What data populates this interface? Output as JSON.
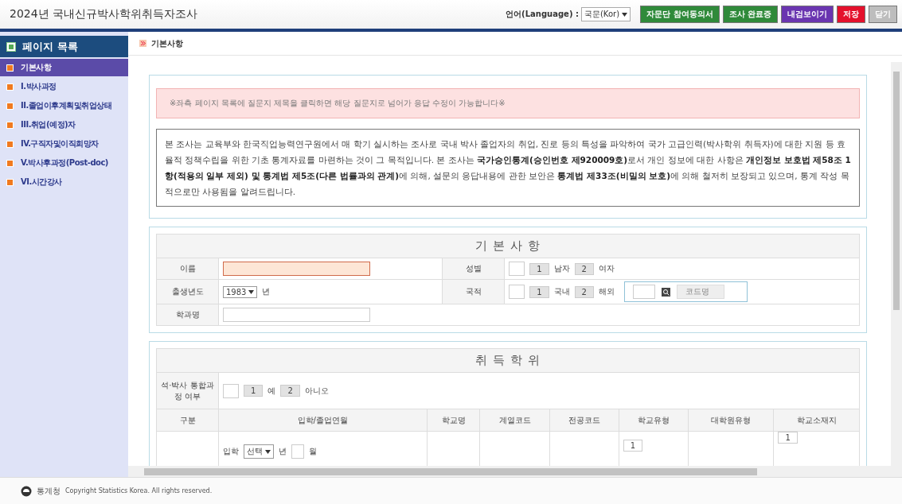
{
  "header": {
    "title": "2024년 국내신규박사학위취득자조사",
    "language_label": "언어(Language) :",
    "language_value": "국문(Kor)",
    "buttons": [
      {
        "label": "자문단 참여동의서",
        "color": "#2f8a3a"
      },
      {
        "label": "조사 완료증",
        "color": "#2f8a3a"
      },
      {
        "label": "내검보이기",
        "color": "#6a35b0"
      },
      {
        "label": "저장",
        "color": "#e4112c"
      },
      {
        "label": "닫기",
        "color": "#bdbdbd"
      }
    ]
  },
  "sidebar": {
    "title": "페이지 목록",
    "items": [
      {
        "label": "기본사항",
        "selected": true
      },
      {
        "label": "I.박사과정",
        "selected": false
      },
      {
        "label": "II.졸업이후계획및취업상태",
        "selected": false
      },
      {
        "label": "III.취업(예정)자",
        "selected": false
      },
      {
        "label": "IV.구직자및이직희망자",
        "selected": false
      },
      {
        "label": "V.박사후과정(Post-doc)",
        "selected": false
      },
      {
        "label": "VI.시간강사",
        "selected": false
      }
    ]
  },
  "breadcrumb": "기본사항",
  "notice": "※좌측 페이지 목록에 질문지 제목을 클릭하면 해당 질문지로 넘어가 응답 수정이 가능합니다※",
  "intro": "본 조사는 교육부와 한국직업능력연구원에서 매 학기 실시하는 조사로 국내 박사 졸업자의 취업, 진로 등의 특성을 파악하여 국가 고급인력(박사학위 취득자)에 대한 지원 등 효율적 정책수립을 위한 기초 통계자료를 마련하는 것이 그 목적입니다. 본 조사는 **국가승인통계(승인번호 제920009호)**로서 개인 정보에 대한 사항은 **개인정보 보호법 제58조 1항(적용의 일부 제외) 및 통계법 제5조(다른 법률과의 관계)**에 의해, 설문의 응답내용에 관한 보안은 **통계법 제33조(비밀의 보호)**에 의해 철저히 보장되고 있으며, 통계 작성 목적으로만 사용됨을 알려드립니다.",
  "basic": {
    "title": "기 본 사 항",
    "name_label": "이름",
    "gender_label": "성별",
    "gender_options": [
      {
        "code": "1",
        "label": "남자"
      },
      {
        "code": "2",
        "label": "여자"
      }
    ],
    "birth_label": "출생년도",
    "birth_year": "1983",
    "birth_unit": "년",
    "nationality_label": "국적",
    "nationality_options": [
      {
        "code": "1",
        "label": "국내"
      },
      {
        "code": "2",
        "label": "해외"
      }
    ],
    "country_placeholder": "코드명",
    "dept_label": "학과명"
  },
  "degree": {
    "title": "취 득 학 위",
    "integrated_label": "석·박사 통합과정 여부",
    "integrated_options": [
      {
        "code": "1",
        "label": "예"
      },
      {
        "code": "2",
        "label": "아니오"
      }
    ],
    "columns": [
      "구분",
      "입학/졸업연월",
      "학교명",
      "계열코드",
      "전공코드",
      "학교유형",
      "대학원유형",
      "학교소재지"
    ],
    "row": {
      "label": "입학",
      "year_select": "선택",
      "year_unit": "년",
      "month_unit": "월",
      "school_type": "1",
      "location": "1"
    }
  },
  "footer": {
    "org": "통계청",
    "copyright": "Copyright Statistics Korea. All rights reserved."
  }
}
